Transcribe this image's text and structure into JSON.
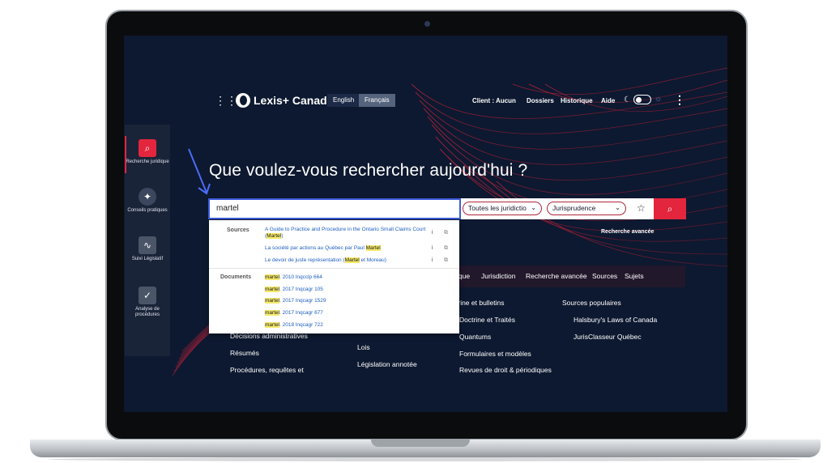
{
  "header": {
    "logo": "Lexis+ Canada",
    "lang_en": "English",
    "lang_fr": "Français",
    "client": "Client : Aucun",
    "dossiers": "Dossiers",
    "historique": "Historique",
    "aide": "Aide"
  },
  "sidebar": {
    "items": [
      {
        "label": "Recherche juridique",
        "icon": "search-icon"
      },
      {
        "label": "Conseils pratiques",
        "icon": "compass-icon"
      },
      {
        "label": "Suivi Législatif",
        "icon": "pulse-icon"
      },
      {
        "label": "Analyse de procédures",
        "icon": "chart-icon"
      }
    ]
  },
  "headline": "Que voulez-vous rechercher aujourd'hui ?",
  "search": {
    "value": "martel",
    "filter_jurisdiction": "Toutes les juridictio",
    "filter_doc": "Jurisprudence",
    "advanced": "Recherche avancée"
  },
  "dropdown": {
    "sources_label": "Sources",
    "documents_label": "Documents",
    "sources": [
      {
        "pre": "A Guide to Practice and Procedure in the Ontario Small Claims Court (",
        "hl": "Martel",
        "post": ")"
      },
      {
        "pre": "La société par actions au Québec par Paul ",
        "hl": "Martel",
        "post": ""
      },
      {
        "pre": "Le devoir de juste représentation (",
        "hl": "Martel",
        "post": " et Moreau)"
      }
    ],
    "documents": [
      {
        "hl": "martel",
        "post": ". 2010 lnqcclp 664"
      },
      {
        "hl": "martel",
        "post": ". 2017 lnqcagr 105"
      },
      {
        "hl": "martel",
        "post": ". 2017 lnqcagr 1529"
      },
      {
        "hl": "martel",
        "post": ". 2017 lnqcagr 677"
      },
      {
        "hl": "martel",
        "post": ". 2018 lnqcagr 722"
      }
    ]
  },
  "nav": {
    "items": [
      "ique",
      "Jurisdiction",
      "Recherche avancée",
      "Sources",
      "Sujets"
    ]
  },
  "content": {
    "col1": [
      "Décisions administratives",
      "Résumés",
      "Procédures, requêtes et"
    ],
    "col2": [
      "Lois",
      "Législation annotée"
    ],
    "col3": [
      "trine et bulletins",
      "Doctrine et Traités",
      "Quantums",
      "Formulaires et modèles",
      "Revues de droit & périodiques"
    ],
    "col4": [
      "Sources populaires",
      "Halsbury's Laws of Canada",
      "JurisClasseur Québec"
    ]
  },
  "colors": {
    "accent": "#e3263d",
    "background": "#0d1930",
    "link": "#1f5fbf",
    "highlight": "#f5e96b"
  }
}
